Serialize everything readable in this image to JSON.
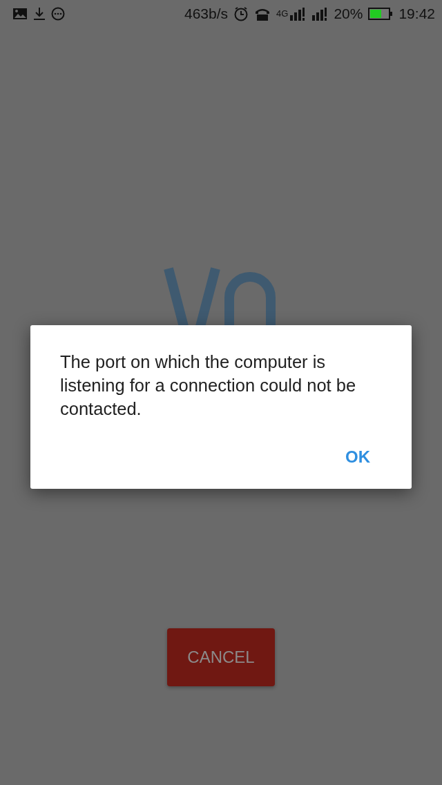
{
  "status_bar": {
    "net_speed": "463b/s",
    "network_type": "4G",
    "battery": "20%",
    "time": "19:42"
  },
  "screen": {
    "cancel_button": "CANCEL"
  },
  "dialog": {
    "message": "The port on which the computer is listening for a connection could not be contacted.",
    "buttons": [
      "OK"
    ]
  }
}
